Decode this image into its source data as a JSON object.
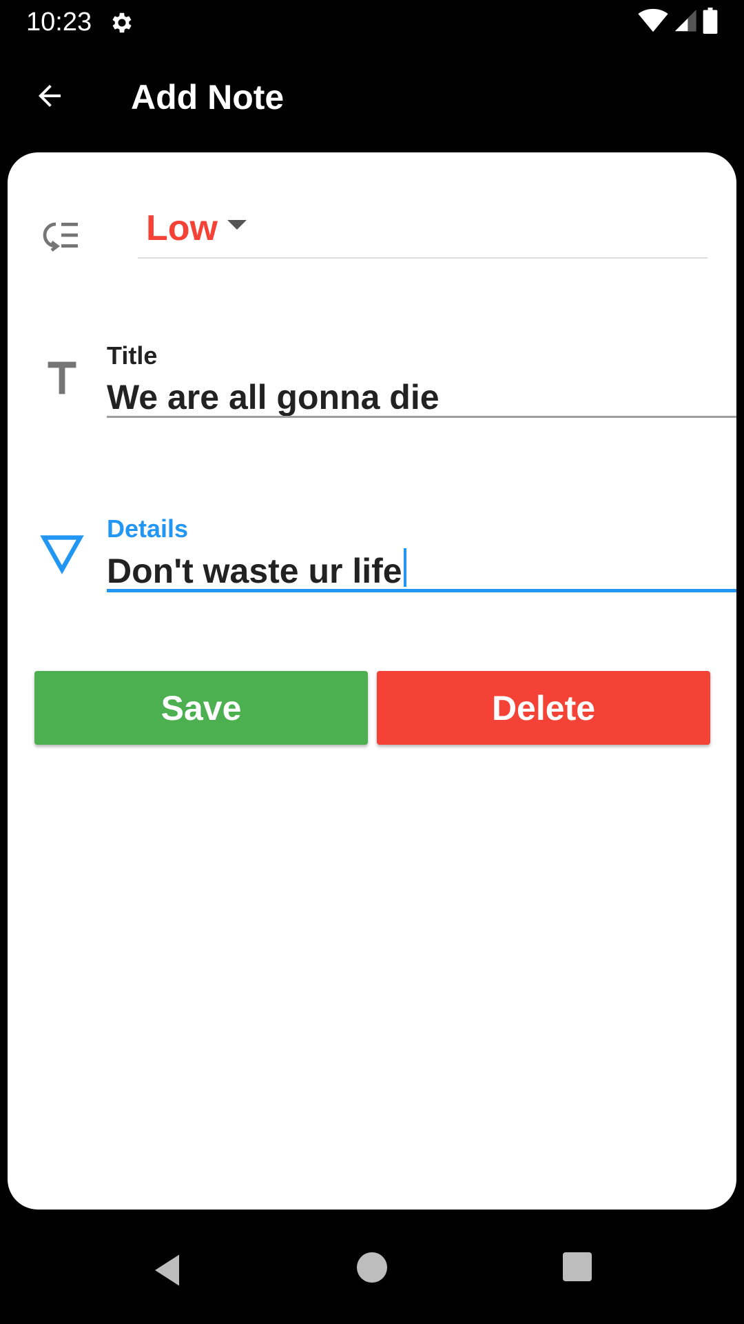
{
  "status_bar": {
    "time": "10:23",
    "icons": [
      "gear-icon",
      "wifi-icon",
      "signal-icon",
      "battery-icon"
    ]
  },
  "app_bar": {
    "title": "Add Note",
    "back_icon": "arrow-back-icon"
  },
  "form": {
    "priority": {
      "icon": "priority-list-icon",
      "selected": "Low",
      "color": "#f44336"
    },
    "title_field": {
      "icon": "text-t-icon",
      "label": "Title",
      "value": "We are all gonna die"
    },
    "details_field": {
      "icon": "triangle-down-icon",
      "label": "Details",
      "value": "Don't waste ur life",
      "accent": "#2196f3"
    }
  },
  "actions": {
    "save_label": "Save",
    "save_color": "#4caf50",
    "delete_label": "Delete",
    "delete_color": "#f44336"
  },
  "nav_bar": {
    "icons": [
      "nav-back-icon",
      "nav-home-icon",
      "nav-recents-icon"
    ]
  }
}
